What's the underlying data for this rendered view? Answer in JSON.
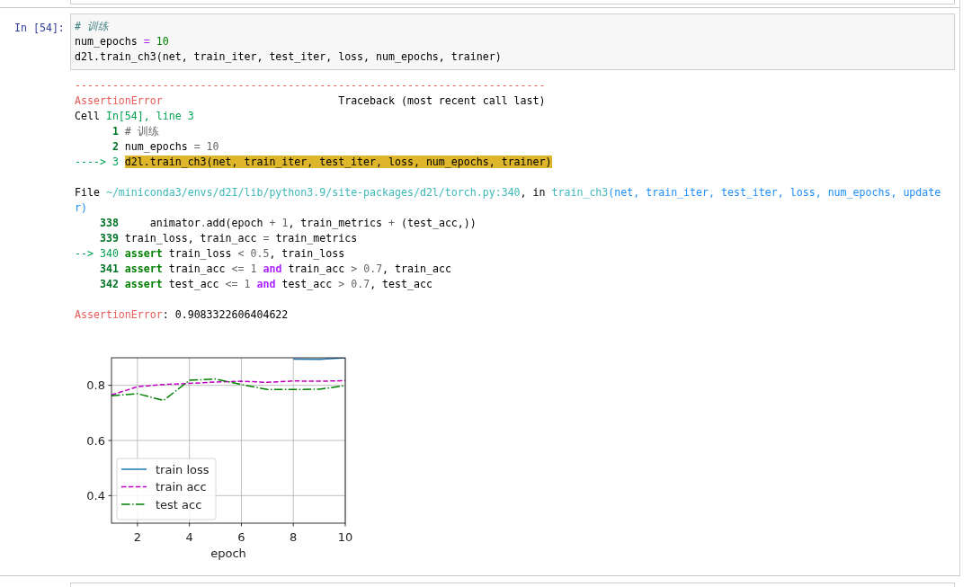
{
  "cell": {
    "prompt": "In [54]:",
    "input_lines": [
      [
        {
          "text": "# 训练",
          "kind": "comment"
        }
      ],
      [
        {
          "text": "num_epochs",
          "kind": "plain"
        },
        {
          "text": " =",
          "kind": "op"
        },
        {
          "text": " 10",
          "kind": "number"
        }
      ],
      [
        {
          "text": "d2l.train_ch3(net, train_iter, test_iter, loss, num_epochs, trainer)",
          "kind": "plain"
        }
      ]
    ],
    "traceback_blocks": [
      [
        [
          {
            "text": "---------------------------------------------------------------------------",
            "kind": "error"
          }
        ],
        [
          {
            "text": "AssertionError",
            "kind": "error"
          },
          {
            "text": "                            Traceback (most recent call last)",
            "kind": "plain"
          }
        ],
        [
          {
            "text": "Cell ",
            "kind": "plain"
          },
          {
            "text": "In[54], line 3",
            "kind": "green"
          }
        ],
        [
          {
            "text": "      1",
            "kind": "lineno"
          },
          {
            "text": " # 训练",
            "kind": "dim"
          }
        ],
        [
          {
            "text": "      2",
            "kind": "lineno"
          },
          {
            "text": " num_epochs",
            "kind": "plain"
          },
          {
            "text": " =",
            "kind": "dim"
          },
          {
            "text": " 10",
            "kind": "dim"
          }
        ],
        [
          {
            "text": "----> 3 ",
            "kind": "green"
          },
          {
            "text": "d2l.train_ch3(net, train_iter, test_iter, loss, num_epochs, trainer)",
            "kind": "highlight"
          }
        ]
      ],
      [
        [
          {
            "text": "File ",
            "kind": "plain"
          },
          {
            "text": "~/miniconda3/envs/d2I/lib/python3.9/site-packages/d2l/torch.py:340",
            "kind": "path"
          },
          {
            "text": ", in ",
            "kind": "plain"
          },
          {
            "text": "train_ch3",
            "kind": "path"
          },
          {
            "text": "(net, train_iter, test_iter, loss, num_epochs, update",
            "kind": "call"
          }
        ],
        [
          {
            "text": "r)",
            "kind": "call"
          }
        ],
        [
          {
            "text": "    338",
            "kind": "lineno"
          },
          {
            "text": "     animator",
            "kind": "plain"
          },
          {
            "text": ".",
            "kind": "dim"
          },
          {
            "text": "add(epoch",
            "kind": "plain"
          },
          {
            "text": " +",
            "kind": "dim"
          },
          {
            "text": " 1",
            "kind": "dim"
          },
          {
            "text": ", train_metrics",
            "kind": "plain"
          },
          {
            "text": " +",
            "kind": "dim"
          },
          {
            "text": " (test_acc,))",
            "kind": "plain"
          }
        ],
        [
          {
            "text": "    339",
            "kind": "lineno"
          },
          {
            "text": " train_loss, train_acc",
            "kind": "plain"
          },
          {
            "text": " =",
            "kind": "dim"
          },
          {
            "text": " train_metrics",
            "kind": "plain"
          }
        ],
        [
          {
            "text": "--> 340 ",
            "kind": "green"
          },
          {
            "text": "assert",
            "kind": "keyword"
          },
          {
            "text": " train_loss",
            "kind": "plain"
          },
          {
            "text": " <",
            "kind": "dim"
          },
          {
            "text": " 0.5",
            "kind": "dim"
          },
          {
            "text": ", train_loss",
            "kind": "plain"
          }
        ],
        [
          {
            "text": "    341",
            "kind": "lineno"
          },
          {
            "text": " assert",
            "kind": "keyword"
          },
          {
            "text": " train_acc",
            "kind": "plain"
          },
          {
            "text": " <=",
            "kind": "dim"
          },
          {
            "text": " 1",
            "kind": "dim"
          },
          {
            "text": " and",
            "kind": "opword"
          },
          {
            "text": " train_acc",
            "kind": "plain"
          },
          {
            "text": " >",
            "kind": "dim"
          },
          {
            "text": " 0.7",
            "kind": "dim"
          },
          {
            "text": ", train_acc",
            "kind": "plain"
          }
        ],
        [
          {
            "text": "    342",
            "kind": "lineno"
          },
          {
            "text": " assert",
            "kind": "keyword"
          },
          {
            "text": " test_acc",
            "kind": "plain"
          },
          {
            "text": " <=",
            "kind": "dim"
          },
          {
            "text": " 1",
            "kind": "dim"
          },
          {
            "text": " and",
            "kind": "opword"
          },
          {
            "text": " test_acc",
            "kind": "plain"
          },
          {
            "text": " >",
            "kind": "dim"
          },
          {
            "text": " 0.7",
            "kind": "dim"
          },
          {
            "text": ", test_acc",
            "kind": "plain"
          }
        ]
      ],
      [
        [
          {
            "text": "AssertionError",
            "kind": "error"
          },
          {
            "text": ": 0.9083322606404622",
            "kind": "plain"
          }
        ]
      ]
    ],
    "chart_data": {
      "type": "line",
      "xlabel": "epoch",
      "x": [
        1,
        2,
        3,
        4,
        5,
        6,
        7,
        8,
        9,
        10
      ],
      "series": [
        {
          "name": "train loss",
          "color": "#1f77b4",
          "line_style": "solid",
          "values": [
            null,
            null,
            null,
            null,
            null,
            null,
            null,
            0.895,
            0.894,
            0.9
          ]
        },
        {
          "name": "train acc",
          "color": "#bf00bf",
          "line_style": "dashed",
          "values": [
            0.765,
            0.795,
            0.803,
            0.807,
            0.812,
            0.815,
            0.811,
            0.816,
            0.815,
            0.817
          ]
        },
        {
          "name": "test acc",
          "color": "#008000",
          "line_style": "dashdot",
          "values": [
            0.762,
            0.77,
            0.745,
            0.818,
            0.823,
            0.803,
            0.785,
            0.785,
            0.786,
            0.799
          ]
        }
      ],
      "xlim": [
        1,
        10
      ],
      "ylim": [
        0.3,
        0.9
      ],
      "xticks": [
        2,
        4,
        6,
        8,
        10
      ],
      "yticks": [
        0.4,
        0.6,
        0.8
      ],
      "grid": true,
      "legend": true
    }
  }
}
